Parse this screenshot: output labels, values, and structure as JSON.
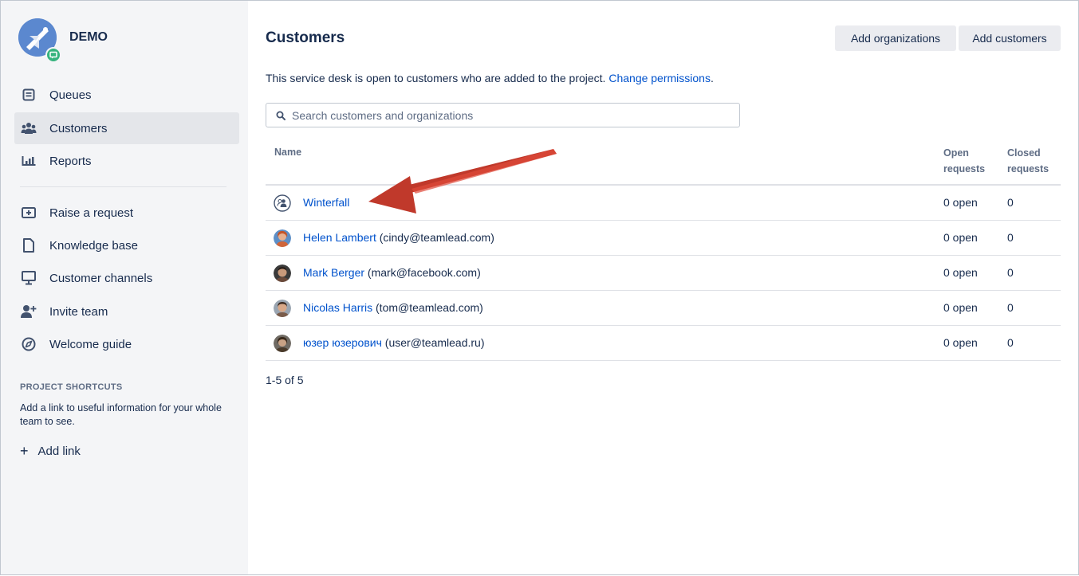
{
  "sidebar": {
    "project_name": "DEMO",
    "nav": [
      {
        "label": "Queues",
        "icon": "queues-icon"
      },
      {
        "label": "Customers",
        "icon": "customers-icon",
        "active": true
      },
      {
        "label": "Reports",
        "icon": "reports-icon"
      }
    ],
    "nav2": [
      {
        "label": "Raise a request",
        "icon": "raise-request-icon"
      },
      {
        "label": "Knowledge base",
        "icon": "document-icon"
      },
      {
        "label": "Customer channels",
        "icon": "monitor-icon"
      },
      {
        "label": "Invite team",
        "icon": "invite-team-icon"
      },
      {
        "label": "Welcome guide",
        "icon": "compass-icon"
      }
    ],
    "shortcuts_title": "PROJECT SHORTCUTS",
    "shortcuts_text": "Add a link to useful information for your whole team to see.",
    "add_link": "Add link"
  },
  "main": {
    "title": "Customers",
    "add_organizations": "Add organizations",
    "add_customers": "Add customers",
    "intro_text": "This service desk is open to customers who are added to the project.",
    "change_permissions": "Change permissions",
    "intro_period": ".",
    "search_placeholder": "Search customers and organizations",
    "columns": {
      "name": "Name",
      "open_l1": "Open",
      "open_l2": "requests",
      "closed_l1": "Closed",
      "closed_l2": "requests"
    },
    "rows": [
      {
        "name": "Winterfall",
        "email": "",
        "open": "0 open",
        "closed": "0",
        "type": "organization"
      },
      {
        "name": "Helen Lambert",
        "email": " (cindy@teamlead.com)",
        "open": "0 open",
        "closed": "0",
        "type": "user",
        "avatar_color": "#d0653a"
      },
      {
        "name": "Mark Berger",
        "email": " (mark@facebook.com)",
        "open": "0 open",
        "closed": "0",
        "type": "user",
        "avatar_color": "#6b4a3a"
      },
      {
        "name": "Nicolas Harris",
        "email": " (tom@teamlead.com)",
        "open": "0 open",
        "closed": "0",
        "type": "user",
        "avatar_color": "#7a5c4a"
      },
      {
        "name": "юзер юзерович",
        "email": " (user@teamlead.ru)",
        "open": "0 open",
        "closed": "0",
        "type": "user",
        "avatar_color": "#4a3a2a"
      }
    ],
    "pager": "1-5 of 5"
  },
  "colors": {
    "link": "#0052cc",
    "sidebar_bg": "#f4f5f7",
    "annotation_arrow": "#d0392b"
  }
}
